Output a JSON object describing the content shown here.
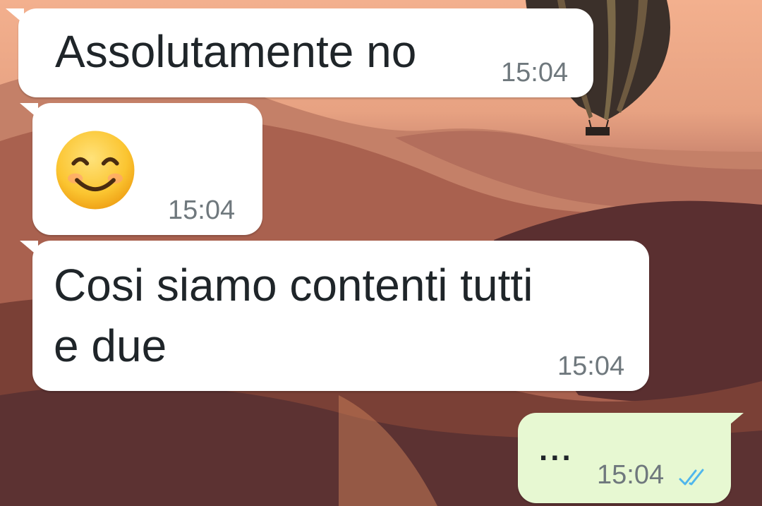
{
  "messages": [
    {
      "direction": "incoming",
      "text": "Assolutamente no",
      "time": "15:04"
    },
    {
      "direction": "incoming",
      "emoji": "smiling-face-with-smiling-eyes",
      "time": "15:04"
    },
    {
      "direction": "incoming",
      "text_line1": "Cosi siamo contenti tutti",
      "text_line2": "e due",
      "time": "15:04"
    },
    {
      "direction": "outgoing",
      "text": "...",
      "time": "15:04",
      "status": "read-double-check"
    }
  ],
  "colors": {
    "incoming_bubble": "#ffffff",
    "outgoing_bubble": "#e7f8d2",
    "time_text": "#6f787d",
    "read_ticks": "#4fb6ec"
  }
}
